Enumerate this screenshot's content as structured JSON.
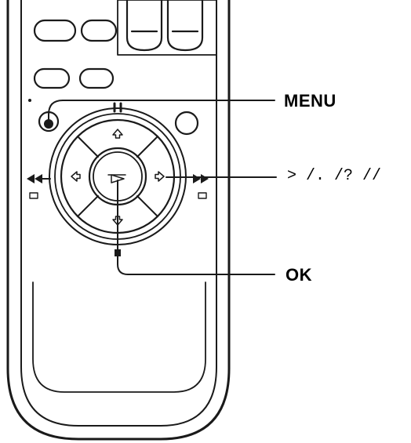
{
  "callouts": {
    "menu": "MENU",
    "arrows": "> /. /? //",
    "ok": "OK"
  },
  "colors": {
    "ink": "#1a1a1a",
    "background": "#ffffff"
  }
}
